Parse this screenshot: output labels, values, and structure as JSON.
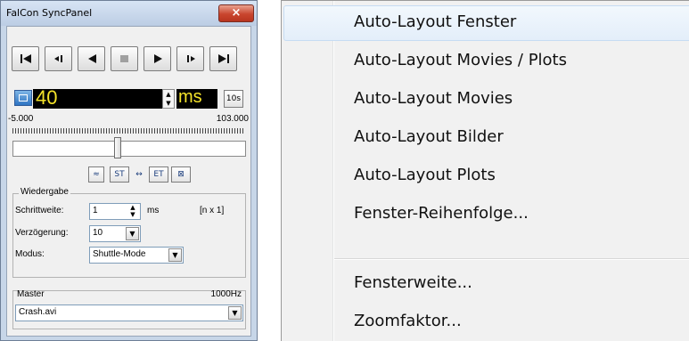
{
  "window": {
    "title": "FalCon SyncPanel",
    "close_glyph": "×"
  },
  "transport": {
    "icons": [
      "skip-to-start-icon",
      "step-back-icon",
      "play-reverse-icon",
      "stop-icon",
      "play-icon",
      "step-forward-icon",
      "skip-to-end-icon"
    ]
  },
  "time": {
    "value": "40",
    "unit": "ms",
    "tenth_button": "10s",
    "spin_up": "▲",
    "spin_down": "▼"
  },
  "range": {
    "min": "-5.000",
    "max": "103.000",
    "slider_fraction": 0.45
  },
  "tools": {
    "collapse": "≈",
    "sync_start": "ST",
    "link": "↔",
    "sync_end": "ET",
    "grid": "⊠"
  },
  "playback": {
    "title": "Wiedergabe",
    "step_label": "Schrittweite:",
    "step_value": "1",
    "step_unit": "ms",
    "step_factor": "[n x 1]",
    "delay_label": "Verzögerung:",
    "delay_value": "10",
    "mode_label": "Modus:",
    "mode_value": "Shuttle-Mode"
  },
  "master": {
    "title": "Master",
    "rate": "1000Hz",
    "file": "Crash.avi"
  },
  "menu": {
    "items": [
      "Auto-Layout Fenster",
      "Auto-Layout Movies / Plots",
      "Auto-Layout Movies",
      "Auto-Layout Bilder",
      "Auto-Layout Plots",
      "Fenster-Reihenfolge...",
      "Fensterweite...",
      "Zoomfaktor..."
    ],
    "highlighted_index": 0
  }
}
